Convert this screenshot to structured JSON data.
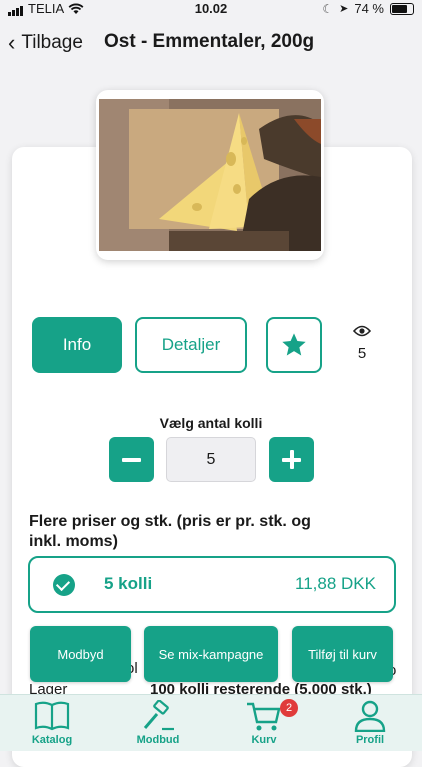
{
  "status_bar": {
    "carrier": "TELIA",
    "time": "10.02",
    "battery": "74 %"
  },
  "nav": {
    "back_label": "Tilbage",
    "title": "Ost - Emmentaler, 200g"
  },
  "product": {
    "image_alt": "Emmentaler cheese with bread"
  },
  "actions": {
    "info": "Info",
    "details": "Detaljer",
    "views": "5"
  },
  "quantity": {
    "label": "Vælg antal kolli",
    "value": "5"
  },
  "prices": {
    "heading": "Flere priser og stk. (pris er pr. stk. og inkl. moms)",
    "option": {
      "qty": "5 kolli",
      "amount": "11,88 DKK"
    }
  },
  "partial_rows": {
    "hidden_1": "ol",
    "hidden_2": "i",
    "hidden_3": "o",
    "lager_label": "Lager",
    "lager_value": "100 kolli resterende (5.000 stk.)"
  },
  "buttons": {
    "modbyd": "Modbyd",
    "mix": "Se mix-kampagne",
    "add_to_cart": "Tilføj til kurv"
  },
  "tabbar": {
    "katalog": "Katalog",
    "modbud": "Modbud",
    "kurv": "Kurv",
    "profil": "Profil",
    "cart_badge": "2"
  },
  "colors": {
    "accent": "#16a288",
    "badge": "#e03b3b",
    "tabbar_bg": "#e8f3f1"
  }
}
